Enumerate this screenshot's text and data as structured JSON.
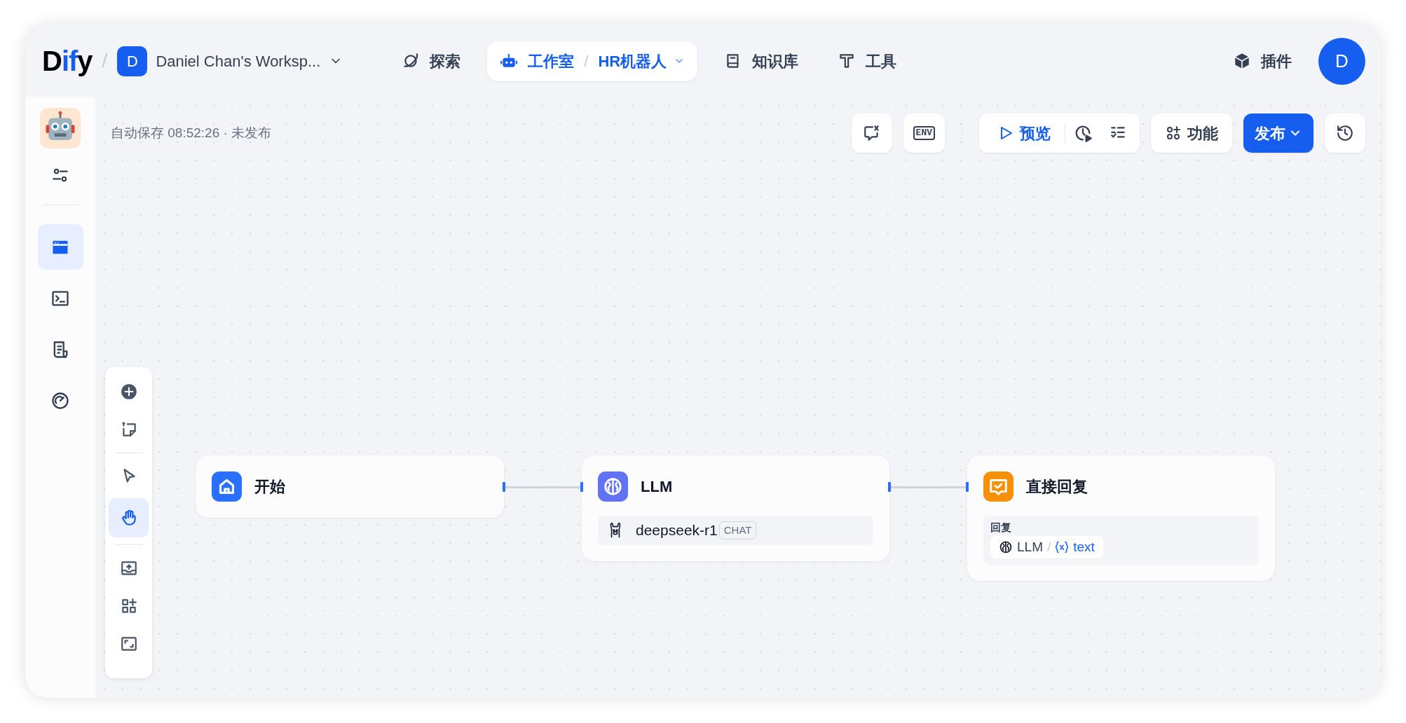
{
  "header": {
    "logo": "Dify",
    "logo_separator": "/",
    "workspace": {
      "avatar": "D",
      "name": "Daniel Chan's Worksp..."
    },
    "nav": [
      {
        "label": "探索",
        "selected": false
      },
      {
        "label": "工作室",
        "selected": true,
        "separator": "/",
        "app": "HR机器人"
      },
      {
        "label": "知识库",
        "selected": false
      },
      {
        "label": "工具",
        "selected": false
      }
    ],
    "plugins": "插件",
    "user_avatar": "D"
  },
  "sidebar": {
    "nav": [
      {
        "selected": true
      },
      {
        "selected": false
      },
      {
        "selected": false
      },
      {
        "selected": false
      }
    ]
  },
  "canvas": {
    "autosave": "自动保存 08:52:26 · 未发布",
    "toolbar": {
      "env": "ENV",
      "preview": "预览",
      "features": "功能",
      "publish": "发布"
    },
    "palette": [
      {
        "selected": false
      },
      {
        "selected": false
      },
      {
        "selected": false
      },
      {
        "selected": true
      },
      {
        "selected": false
      },
      {
        "selected": false
      },
      {
        "selected": false
      }
    ],
    "nodes": [
      {
        "kind": "start",
        "title": "开始"
      },
      {
        "kind": "llm",
        "title": "LLM",
        "model": "deepseek-r1",
        "mode": "CHAT"
      },
      {
        "kind": "answer",
        "title": "直接回复",
        "field_label": "回复",
        "ref_node": "LLM",
        "ref_separator": "/",
        "ref_var": "text"
      }
    ]
  }
}
